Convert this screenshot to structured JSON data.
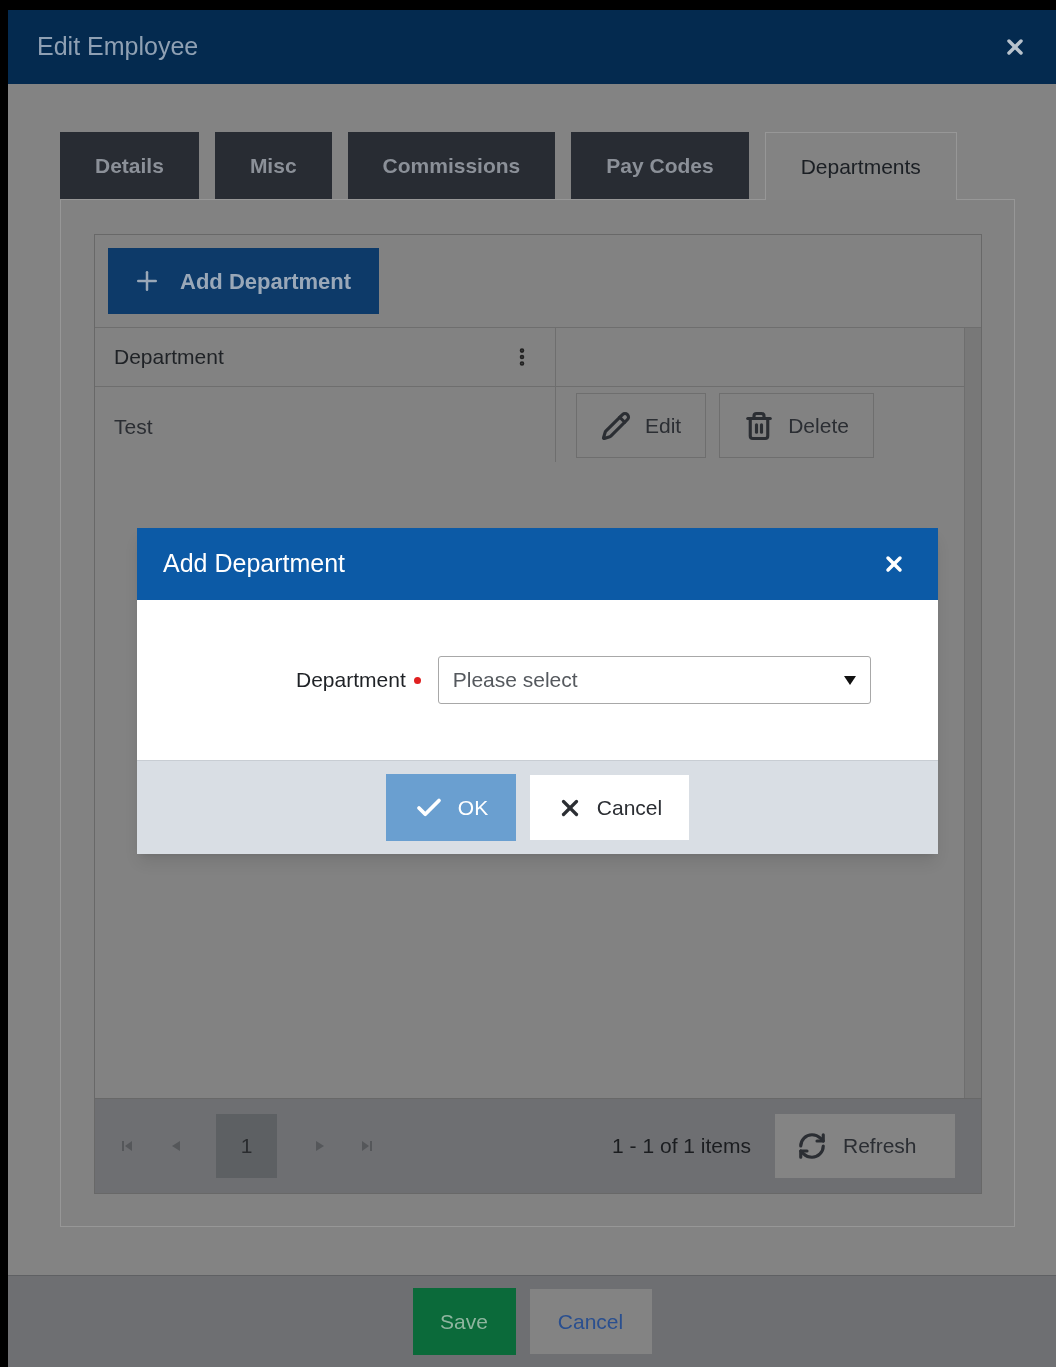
{
  "window": {
    "title": "Edit Employee"
  },
  "tabs": [
    {
      "label": "Details",
      "selected": false
    },
    {
      "label": "Misc",
      "selected": false
    },
    {
      "label": "Commissions",
      "selected": false
    },
    {
      "label": "Pay Codes",
      "selected": false
    },
    {
      "label": "Departments",
      "selected": true
    }
  ],
  "toolbar": {
    "add_button": "Add Department"
  },
  "table": {
    "columns": [
      "Department"
    ],
    "rows": [
      {
        "department": "Test",
        "actions": [
          "Edit",
          "Delete"
        ]
      }
    ]
  },
  "pager": {
    "pages": [
      {
        "label": "1",
        "selected": true
      }
    ],
    "info": "1 - 1 of 1 items",
    "refresh": "Refresh"
  },
  "dialog": {
    "title": "Add Department",
    "field": {
      "label": "Department",
      "required": true,
      "placeholder": "Please select"
    },
    "buttons": [
      "OK",
      "Cancel"
    ]
  },
  "footer": {
    "buttons": [
      "Save",
      "Cancel"
    ]
  }
}
